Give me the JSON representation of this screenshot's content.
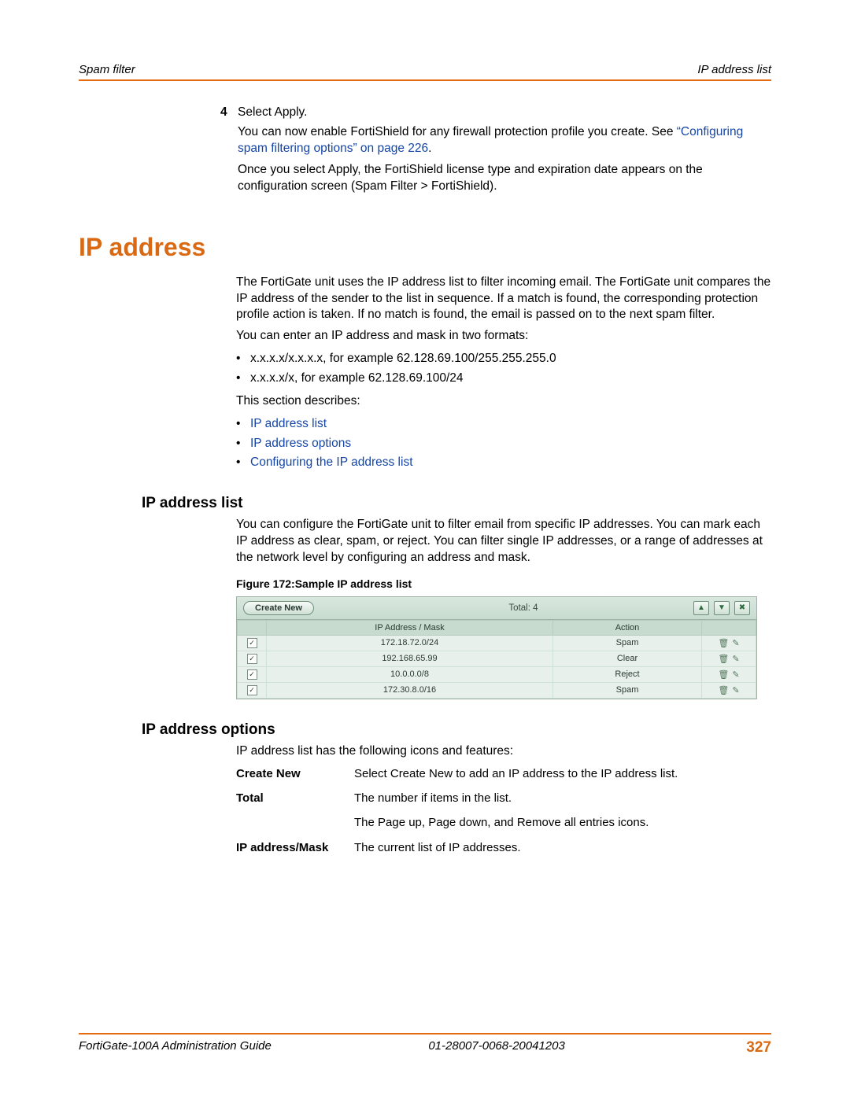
{
  "header": {
    "left": "Spam filter",
    "right": "IP address list"
  },
  "step": {
    "num": "4",
    "line1": "Select Apply.",
    "line2a": "You can now enable FortiShield for any firewall protection profile you create. See ",
    "link": "“Configuring spam filtering options” on page 226",
    "line2b": ".",
    "line3": "Once you select Apply, the FortiShield license type and expiration date appears on the configuration screen (Spam Filter > FortiShield)."
  },
  "section_title": "IP address",
  "ip_intro": "The FortiGate unit uses the IP address list to filter incoming email. The FortiGate unit compares the IP address of the sender to the list in sequence. If a match is found, the corresponding protection profile action is taken. If no match is found, the email is passed on to the next spam filter.",
  "ip_formats_lead": "You can enter an IP address and mask in two formats:",
  "ip_formats": [
    "x.x.x.x/x.x.x.x, for example 62.128.69.100/255.255.255.0",
    "x.x.x.x/x, for example 62.128.69.100/24"
  ],
  "describes_lead": "This section describes:",
  "describes": [
    "IP address list",
    "IP address options",
    "Configuring the IP address list"
  ],
  "sub1": {
    "title": "IP address list",
    "body": "You can configure the FortiGate unit to filter email from specific IP addresses. You can mark each IP address as clear, spam, or reject. You can filter single IP addresses, or a range of addresses at the network level by configuring an address and mask."
  },
  "figure_caption": "Figure 172:Sample IP address list",
  "shot": {
    "create_label": "Create New",
    "total_label": "Total: 4",
    "columns": {
      "check": "",
      "ip": "IP Address / Mask",
      "action": "Action",
      "icons": ""
    },
    "rows": [
      {
        "checked": true,
        "ip": "172.18.72.0/24",
        "action": "Spam"
      },
      {
        "checked": true,
        "ip": "192.168.65.99",
        "action": "Clear"
      },
      {
        "checked": true,
        "ip": "10.0.0.0/8",
        "action": "Reject"
      },
      {
        "checked": true,
        "ip": "172.30.8.0/16",
        "action": "Spam"
      }
    ]
  },
  "sub2": {
    "title": "IP address options",
    "lead": "IP address list has the following icons and features:"
  },
  "defs": [
    {
      "term": "Create New",
      "desc": "Select Create New to add an IP address to the IP address list."
    },
    {
      "term": "Total",
      "desc": "The number if items in the list."
    },
    {
      "term": "",
      "desc": "The Page up, Page down, and Remove all entries icons."
    },
    {
      "term": "IP address/Mask",
      "desc": "The current list of IP addresses."
    }
  ],
  "footer": {
    "left": "FortiGate-100A Administration Guide",
    "mid": "01-28007-0068-20041203",
    "page": "327"
  }
}
